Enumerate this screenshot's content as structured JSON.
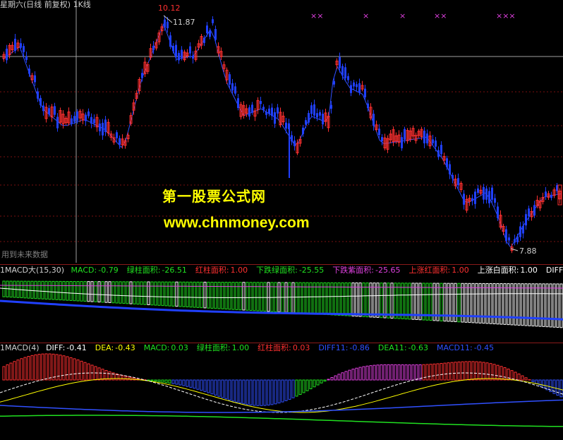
{
  "main": {
    "title": "星期六(日线 前复权) 1K线",
    "high_mark": "10.12",
    "high_label": "11.87",
    "low_label": "7.88",
    "x_marks": [
      "××",
      "×",
      "×",
      "××",
      "×××"
    ],
    "note": "用到未来数据",
    "watermark_cn": "第一股票公式网",
    "watermark_url": "www.chnmoney.com"
  },
  "panel1": {
    "name": "1MACD大(15,30)",
    "items": [
      {
        "label": "MACD:",
        "value": "-0.79",
        "color": "#20e020"
      },
      {
        "label": "绿柱面积:",
        "value": "-26.51",
        "color": "#20e020"
      },
      {
        "label": "红柱面积:",
        "value": "1.00",
        "color": "#ff3030"
      },
      {
        "label": "下跌绿面积:",
        "value": "-25.55",
        "color": "#20e020"
      },
      {
        "label": "下跌紫面积:",
        "value": "-25.65",
        "color": "#e040e0"
      },
      {
        "label": "上涨红面积:",
        "value": "1.00",
        "color": "#ff3030"
      },
      {
        "label": "上涨白面积:",
        "value": "1.00",
        "color": "#ffffff"
      },
      {
        "label": "DIFF",
        "value": "",
        "color": "#ffffff"
      }
    ]
  },
  "panel2": {
    "name": "1MACD(4)",
    "items": [
      {
        "label": "DIFF:",
        "value": "-0.41",
        "color": "#ffffff"
      },
      {
        "label": "DEA:",
        "value": "-0.43",
        "color": "#ffff00"
      },
      {
        "label": "MACD:",
        "value": "0.03",
        "color": "#20e020"
      },
      {
        "label": "绿柱面积:",
        "value": "1.00",
        "color": "#20e020"
      },
      {
        "label": "红柱面积:",
        "value": "0.03",
        "color": "#ff3030"
      },
      {
        "label": "DIFF11:",
        "value": "-0.86",
        "color": "#3050ff"
      },
      {
        "label": "DEA11:",
        "value": "-0.63",
        "color": "#20e020"
      },
      {
        "label": "MACD11:",
        "value": "-0.45",
        "color": "#3050ff"
      }
    ]
  },
  "colors": {
    "up": "#ff3030",
    "down": "#2040ff",
    "grid": "#7a1010",
    "magenta": "#e040e0"
  }
}
